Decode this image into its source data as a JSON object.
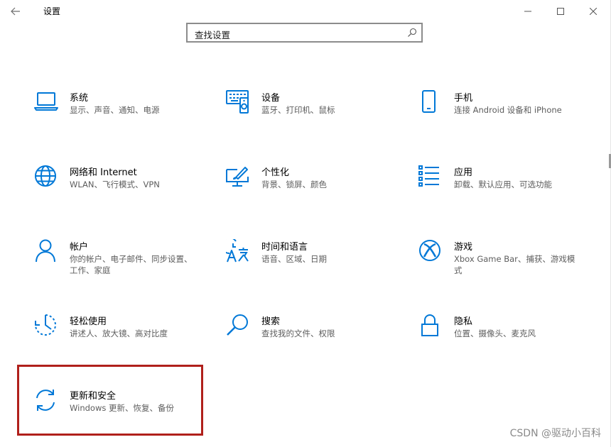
{
  "window": {
    "title": "设置",
    "back_icon": "arrow-left-icon",
    "controls": [
      "minimize-icon",
      "maximize-icon",
      "close-icon"
    ]
  },
  "search": {
    "placeholder": "查找设置",
    "icon": "search-icon"
  },
  "accent_color": "#0078d7",
  "highlight_color": "#b0201b",
  "categories": [
    {
      "title": "系统",
      "desc": "显示、声音、通知、电源",
      "icon": "laptop-icon"
    },
    {
      "title": "设备",
      "desc": "蓝牙、打印机、鼠标",
      "icon": "keyboard-devices-icon"
    },
    {
      "title": "手机",
      "desc": "连接 Android 设备和 iPhone",
      "icon": "phone-icon"
    },
    {
      "title": "网络和 Internet",
      "desc": "WLAN、飞行模式、VPN",
      "icon": "globe-icon"
    },
    {
      "title": "个性化",
      "desc": "背景、锁屏、颜色",
      "icon": "personalization-icon"
    },
    {
      "title": "应用",
      "desc": "卸载、默认应用、可选功能",
      "icon": "apps-list-icon"
    },
    {
      "title": "帐户",
      "desc": "你的帐户、电子邮件、同步设置、工作、家庭",
      "icon": "person-icon"
    },
    {
      "title": "时间和语言",
      "desc": "语音、区域、日期",
      "icon": "time-language-icon"
    },
    {
      "title": "游戏",
      "desc": "Xbox Game Bar、捕获、游戏模式",
      "icon": "xbox-icon"
    },
    {
      "title": "轻松使用",
      "desc": "讲述人、放大镜、高对比度",
      "icon": "ease-of-access-icon"
    },
    {
      "title": "搜索",
      "desc": "查找我的文件、权限",
      "icon": "search-magnifier-icon"
    },
    {
      "title": "隐私",
      "desc": "位置、摄像头、麦克风",
      "icon": "lock-icon"
    },
    {
      "title": "更新和安全",
      "desc": "Windows 更新、恢复、备份",
      "icon": "sync-icon"
    }
  ],
  "watermark": "CSDN @驱动小百科"
}
